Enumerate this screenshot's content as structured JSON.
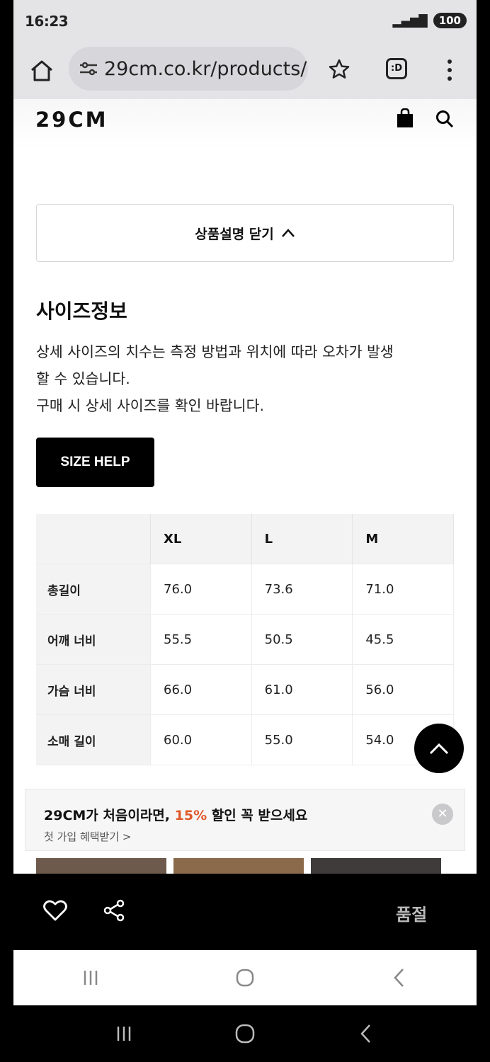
{
  "status": {
    "time": "16:23",
    "battery": "100"
  },
  "browser": {
    "url": "29cm.co.kr/products/"
  },
  "header": {
    "logo": "29CM"
  },
  "description_toggle": {
    "label": "상품설명 닫기"
  },
  "size_section": {
    "title": "사이즈정보",
    "desc_line1": "상세 사이즈의 치수는 측정 방법과 위치에 따라 오차가 발생",
    "desc_line2": "할 수 있습니다.",
    "desc_line3": "구매 시 상세 사이즈를 확인 바랍니다.",
    "help_button": "SIZE HELP"
  },
  "size_table": {
    "columns": [
      "XL",
      "L",
      "M"
    ],
    "rows": [
      {
        "label": "총길이",
        "values": [
          "76.0",
          "73.6",
          "71.0"
        ]
      },
      {
        "label": "어깨 너비",
        "values": [
          "55.5",
          "50.5",
          "45.5"
        ]
      },
      {
        "label": "가슴 너비",
        "values": [
          "66.0",
          "61.0",
          "56.0"
        ]
      },
      {
        "label": "소매 길이",
        "values": [
          "60.0",
          "55.0",
          "54.0"
        ]
      }
    ]
  },
  "promo": {
    "msg_before": "29CM가 처음이라면, ",
    "msg_pct": "15%",
    "msg_after": " 할인 꼭 받으세요",
    "link": "첫 가입 혜택받기 >"
  },
  "bottom_bar": {
    "status": "품절"
  },
  "colors": {
    "accent": "#e0592a",
    "button": "#000000"
  }
}
